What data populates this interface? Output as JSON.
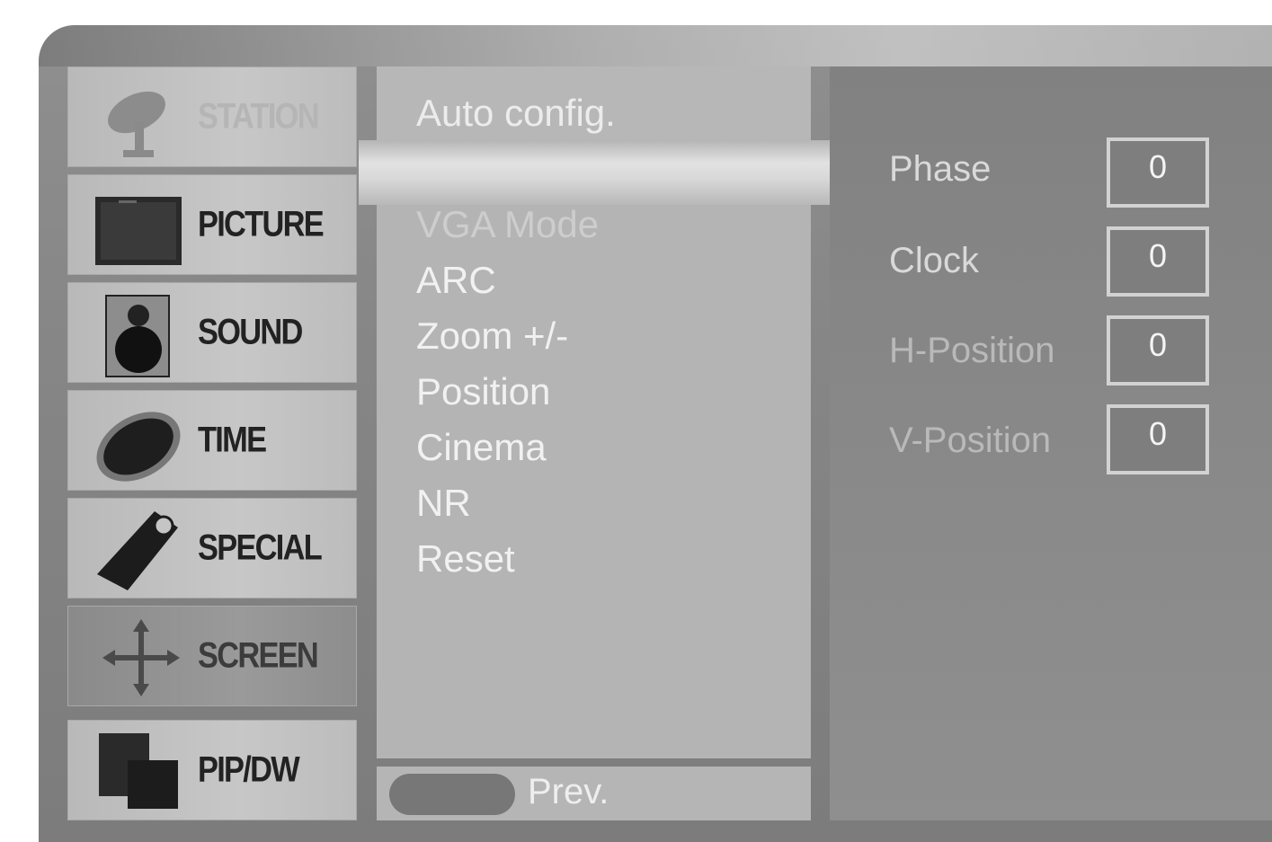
{
  "categories": [
    {
      "label": "STATION",
      "icon": "satellite-dish-icon",
      "state": "dim"
    },
    {
      "label": "PICTURE",
      "icon": "tv-screen-icon",
      "state": "normal"
    },
    {
      "label": "SOUND",
      "icon": "speaker-icon",
      "state": "normal"
    },
    {
      "label": "TIME",
      "icon": "clock-dial-icon",
      "state": "normal"
    },
    {
      "label": "SPECIAL",
      "icon": "tag-icon",
      "state": "normal"
    },
    {
      "label": "SCREEN",
      "icon": "move-arrows-icon",
      "state": "active"
    },
    {
      "label": "PIP/DW",
      "icon": "pip-windows-icon",
      "state": "normal"
    }
  ],
  "menu": {
    "header": "Auto config.",
    "items": [
      "VGA Mode",
      "ARC",
      "Zoom +/-",
      "Position",
      "Cinema",
      "NR",
      "Reset"
    ]
  },
  "footer": {
    "prev_label": "Prev."
  },
  "settings": [
    {
      "label": "Phase",
      "value": "0"
    },
    {
      "label": "Clock",
      "value": "0"
    },
    {
      "label": "H-Position",
      "value": "0"
    },
    {
      "label": "V-Position",
      "value": "0"
    }
  ]
}
